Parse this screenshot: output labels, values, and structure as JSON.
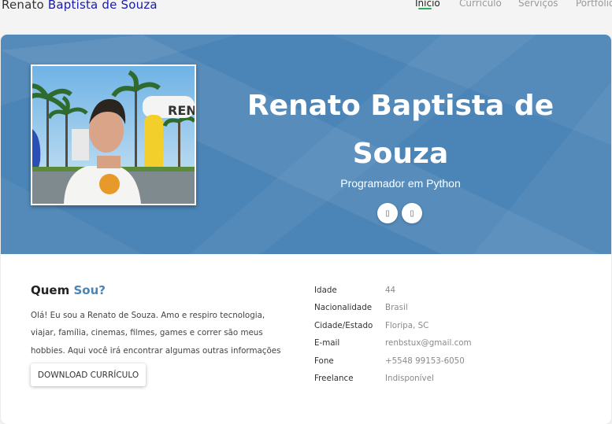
{
  "header": {
    "brand_first": "Renato",
    "brand_rest": "Baptista de Souza",
    "nav": [
      {
        "label": "Início",
        "active": true
      },
      {
        "label": "Currículo",
        "active": false
      },
      {
        "label": "Serviços",
        "active": false
      },
      {
        "label": "Portfólio",
        "active": false
      }
    ]
  },
  "hero": {
    "name_line1": "Renato Baptista de",
    "name_line2": "Souza",
    "role": "Programador em Python",
    "social": [
      {
        "icon": "social-icon-1",
        "glyph": "▯"
      },
      {
        "icon": "social-icon-2",
        "glyph": "▯"
      }
    ],
    "background_color": "#4b84b6"
  },
  "about": {
    "title_first": "Quem",
    "title_accent": "Sou?",
    "text": "Olá! Eu sou a Renato de Souza. Amo e respiro tecnologia, viajar, família, cinemas, filmes, games e correr são meus hobbies. Aqui você irá encontrar algumas outras informações sobre mim.",
    "download_label": "DOWNLOAD CURRÍCULO"
  },
  "info": [
    {
      "label": "Idade",
      "value": "44"
    },
    {
      "label": "Nacionalidade",
      "value": "Brasil"
    },
    {
      "label": "Cidade/Estado",
      "value": "Floripa, SC"
    },
    {
      "label": "E-mail",
      "value": "renbstux@gmail.com"
    },
    {
      "label": "Fone",
      "value": "+5548 99153-6050"
    },
    {
      "label": "Freelance",
      "value": "Indisponível"
    }
  ],
  "colors": {
    "accent": "#4b84b6",
    "nav_active_underline": "#27ae60",
    "brand_accent": "#1a1aa8"
  }
}
